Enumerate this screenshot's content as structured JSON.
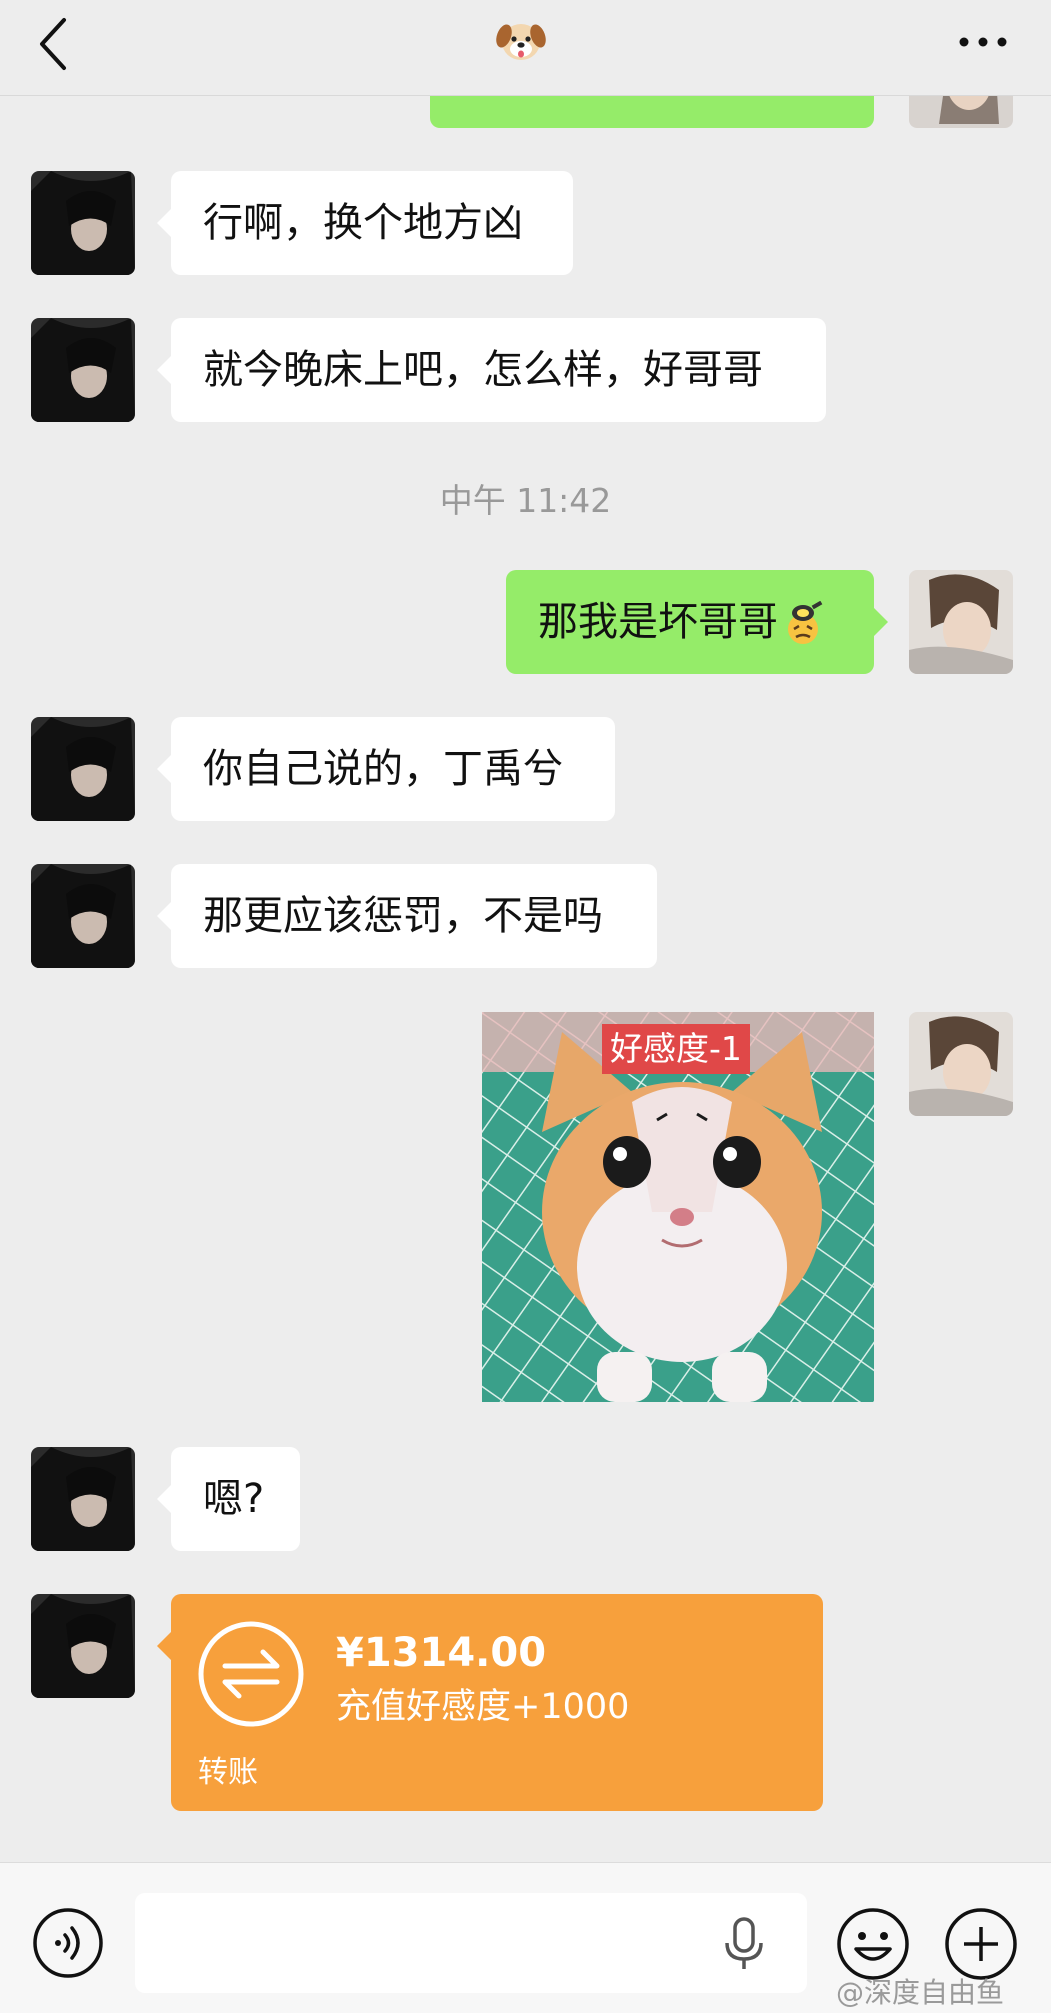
{
  "header": {
    "back_icon": "chevron-left-icon",
    "title_icon": "dog-face-emoji",
    "more_icon": "ellipsis-icon"
  },
  "messages": [
    {
      "side": "left",
      "text": "行啊，换个地方凶"
    },
    {
      "side": "left",
      "text": "就今晚床上吧，怎么样，好哥哥"
    },
    {
      "type": "timestamp",
      "text": "中午 11:42"
    },
    {
      "side": "right",
      "text": "那我是坏哥哥",
      "emoji": "frying-pan-face-emoji"
    },
    {
      "side": "left",
      "text": "你自己说的，丁禹兮"
    },
    {
      "side": "left",
      "text": "那更应该惩罚，不是吗"
    },
    {
      "side": "right",
      "type": "sticker",
      "caption": "好感度-1"
    },
    {
      "side": "left",
      "text": "嗯?"
    },
    {
      "side": "left",
      "type": "transfer",
      "amount": "¥1314.00",
      "note": "充值好感度+1000",
      "label": "转账"
    }
  ],
  "input_bar": {
    "placeholder": "",
    "voice_icon": "voice-icon",
    "mic_icon": "microphone-icon",
    "emoji_icon": "emoji-icon",
    "plus_icon": "plus-icon"
  },
  "watermark": "@深度自由鱼",
  "colors": {
    "background": "#ededed",
    "bubble_self": "#95ec69",
    "bubble_other": "#ffffff",
    "transfer": "#f7a03c",
    "timestamp": "#999999"
  }
}
